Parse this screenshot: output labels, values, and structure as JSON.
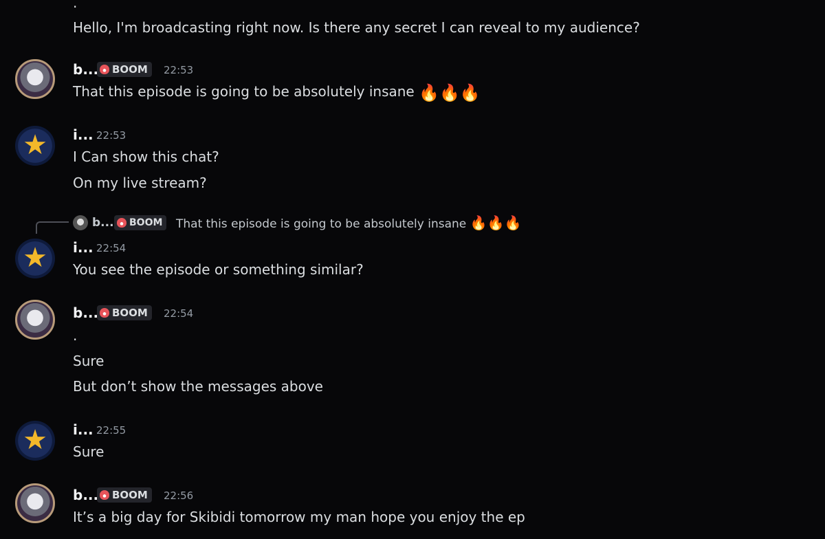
{
  "messages": {
    "m0": {
      "dot": ".",
      "text": "Hello, I'm broadcasting right now. Is there any secret I can reveal to my audience?"
    },
    "m1": {
      "user": "b...",
      "tag": "BOOM",
      "time": "22:53",
      "text": "That this episode is going to be absolutely insane",
      "emoji": "🔥🔥🔥"
    },
    "m2": {
      "user": "i...",
      "time": "22:53",
      "line1": "I Can show this chat?",
      "line2": "On my live stream?"
    },
    "m3": {
      "reply": {
        "user": "b...",
        "tag": "BOOM",
        "text": "That this episode is going to be absolutely insane",
        "emoji": "🔥🔥🔥"
      },
      "user": "i...",
      "time": "22:54",
      "text": "You see the episode or something similar?"
    },
    "m4": {
      "user": "b...",
      "tag": "BOOM",
      "time": "22:54",
      "dot": ".",
      "line1": "Sure",
      "line2": "But don’t show the messages above"
    },
    "m5": {
      "user": "i...",
      "time": "22:55",
      "text": "Sure"
    },
    "m6": {
      "user": "b...",
      "tag": "BOOM",
      "time": "22:56",
      "text": "It’s a big day for Skibidi tomorrow my man hope you enjoy the ep"
    }
  },
  "icons": {
    "star": "★",
    "tag_icon": "guild-tag-icon",
    "panda": "panda-avatar",
    "star_avatar": "star-avatar"
  }
}
